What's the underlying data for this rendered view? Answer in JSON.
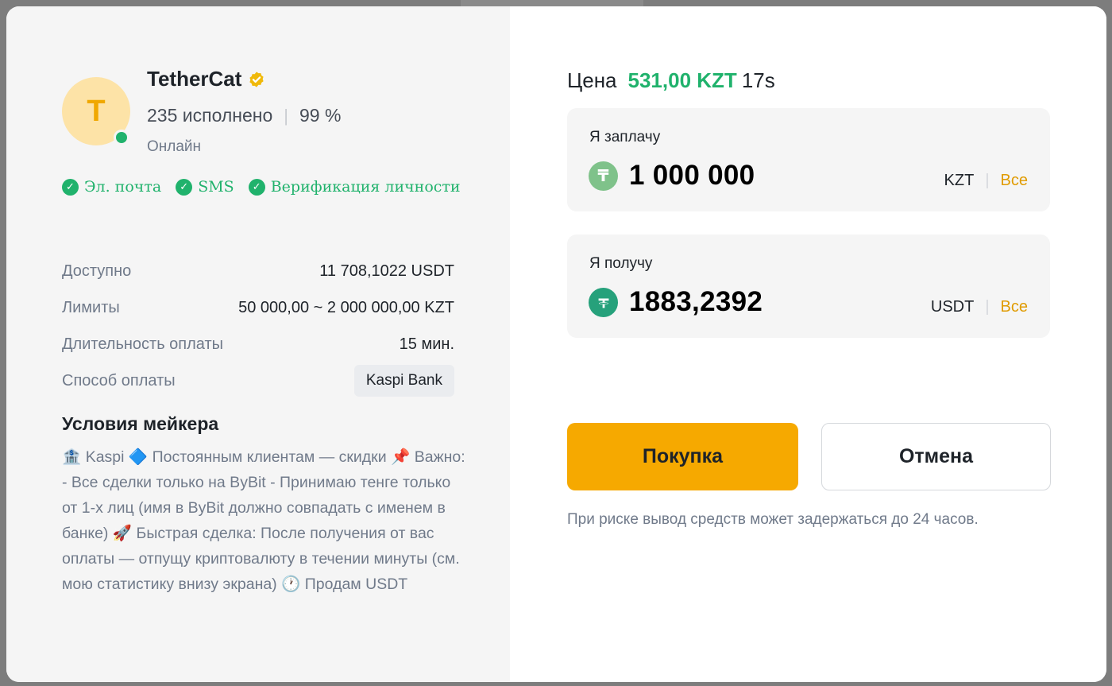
{
  "seller": {
    "avatar_letter": "T",
    "name": "TetherCat",
    "completed": "235 исполнено",
    "completion_rate": "99 %",
    "status": "Онлайн"
  },
  "verifications": [
    {
      "label": "Эл. почта"
    },
    {
      "label": "SMS"
    },
    {
      "label": "Верификация личности"
    }
  ],
  "info": {
    "available_label": "Доступно",
    "available_value": "11 708,1022 USDT",
    "limits_label": "Лимиты",
    "limits_value": "50 000,00 ~ 2 000 000,00 KZT",
    "duration_label": "Длительность оплаты",
    "duration_value": "15 мин.",
    "payment_label": "Способ оплаты",
    "payment_value": "Kaspi Bank"
  },
  "terms": {
    "title": "Условия мейкера",
    "text": "🏦 Kaspi 🔷 Постоянным клиентам — скидки 📌 Важно: - Все сделки только на ByBit - Принимаю тенге только от 1-х лиц (имя в ByBit должно совпадать с именем в банке) 🚀 Быстрая сделка: После получения от вас оплаты — отпущу криптовалюту в течении минуты (см. мою статистику внизу экрана) 🕐 Продам USDT"
  },
  "order": {
    "price_label": "Цена",
    "price_value": "531,00 KZT",
    "timer": "17s",
    "pay": {
      "label": "Я заплачу",
      "amount": "1 000 000",
      "currency": "KZT",
      "all_label": "Все",
      "icon": "tenge-icon"
    },
    "receive": {
      "label": "Я получу",
      "amount": "1883,2392",
      "currency": "USDT",
      "all_label": "Все",
      "icon": "tether-icon"
    },
    "buy_label": "Покупка",
    "cancel_label": "Отмена",
    "risk_note": "При риске вывод средств может задержаться до 24 часов."
  },
  "colors": {
    "accent": "#f6a900",
    "positive": "#20b26c",
    "secondary_text": "#707a8a"
  }
}
